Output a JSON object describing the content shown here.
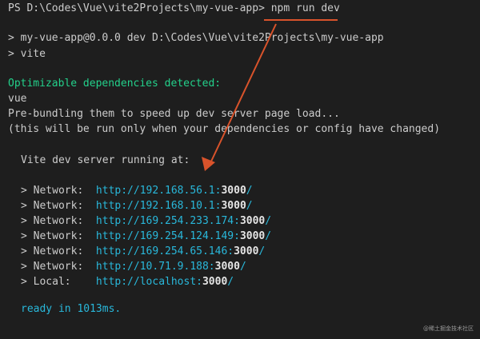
{
  "terminal": {
    "prompt_line": {
      "prompt": "PS D:\\Codes\\Vue\\vite2Projects\\my-vue-app> ",
      "command": "npm run dev"
    },
    "script_line": "> my-vue-app@0.0.0 dev D:\\Codes\\Vue\\vite2Projects\\my-vue-app",
    "vite_line": "> vite",
    "optimize_header": "Optimizable dependencies detected:",
    "dependency": "vue",
    "prebundle_line": "Pre-bundling them to speed up dev server page load...",
    "rerun_note": "(this will be run only when your dependencies or config have changed)",
    "server_running": "Vite dev server running at:",
    "servers": [
      {
        "label": "> Network:  ",
        "url_prefix": "http://192.168.56.1:",
        "port": "3000",
        "suffix": "/"
      },
      {
        "label": "> Network:  ",
        "url_prefix": "http://192.168.10.1:",
        "port": "3000",
        "suffix": "/"
      },
      {
        "label": "> Network:  ",
        "url_prefix": "http://169.254.233.174:",
        "port": "3000",
        "suffix": "/"
      },
      {
        "label": "> Network:  ",
        "url_prefix": "http://169.254.124.149:",
        "port": "3000",
        "suffix": "/"
      },
      {
        "label": "> Network:  ",
        "url_prefix": "http://169.254.65.146:",
        "port": "3000",
        "suffix": "/"
      },
      {
        "label": "> Network:  ",
        "url_prefix": "http://10.71.9.188:",
        "port": "3000",
        "suffix": "/"
      },
      {
        "label": "> Local:    ",
        "url_prefix": "http://localhost:",
        "port": "3000",
        "suffix": "/"
      }
    ],
    "ready_line": "ready in 1013ms."
  },
  "watermark": "@稀土掘金技术社区",
  "colors": {
    "background": "#1e1e1e",
    "text": "#cccccc",
    "green": "#23d18b",
    "cyan": "#29b8db",
    "annotation": "#d9532b"
  }
}
